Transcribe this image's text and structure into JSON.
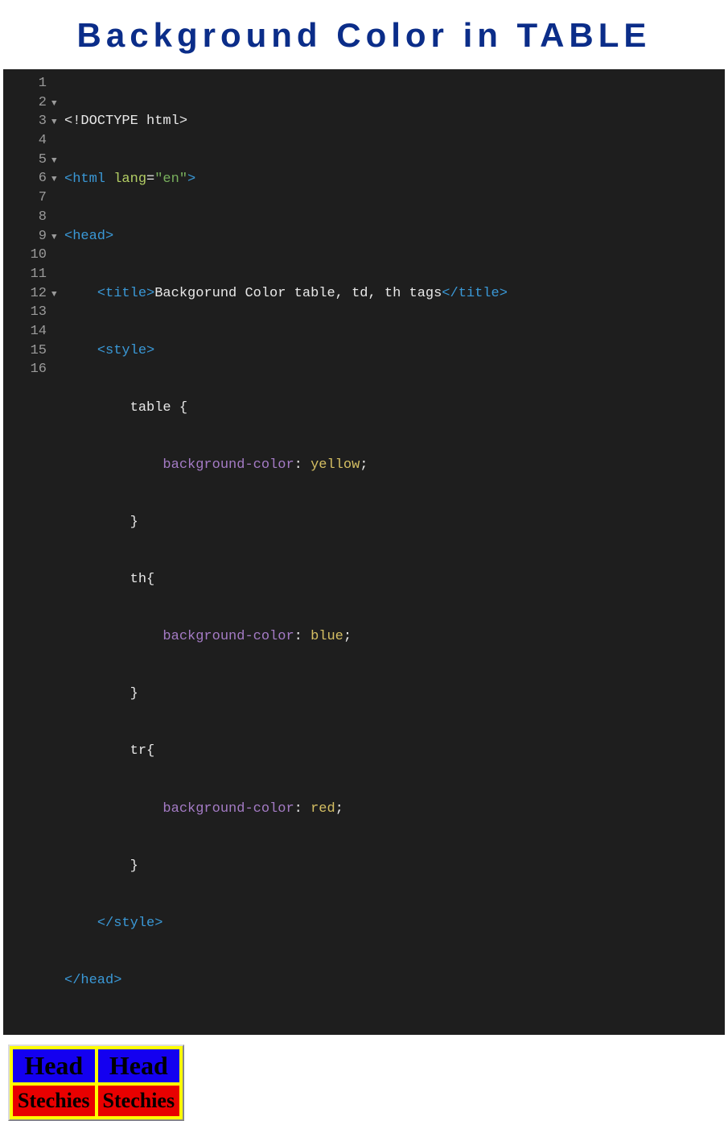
{
  "title": "Background Color in TABLE",
  "code": {
    "line1": {
      "text": "<!DOCTYPE html>"
    },
    "line2": {
      "open": "<",
      "tag": "html",
      "attr": "lang",
      "eq": "=",
      "val": "\"en\"",
      "close": ">"
    },
    "line3": {
      "open": "<",
      "tag": "head",
      "close": ">"
    },
    "line4": {
      "indent": "    ",
      "open": "<",
      "tag": "title",
      "close1": ">",
      "text": "Backgorund Color table, td, th tags",
      "open2": "</",
      "tag2": "title",
      "close2": ">"
    },
    "line5": {
      "indent": "    ",
      "open": "<",
      "tag": "style",
      "close": ">"
    },
    "line6": {
      "indent": "        ",
      "sel": "table {"
    },
    "line7": {
      "indent": "            ",
      "prop": "background-color",
      "colon": ": ",
      "val": "yellow",
      "semi": ";"
    },
    "line8": {
      "indent": "        ",
      "brace": "}"
    },
    "line9": {
      "indent": "        ",
      "sel": "th{"
    },
    "line10": {
      "indent": "            ",
      "prop": "background-color",
      "colon": ": ",
      "val": "blue",
      "semi": ";"
    },
    "line11": {
      "indent": "        ",
      "brace": "}"
    },
    "line12": {
      "indent": "        ",
      "sel": "tr{"
    },
    "line13": {
      "indent": "            ",
      "prop": "background-color",
      "colon": ": ",
      "val": "red",
      "semi": ";"
    },
    "line14": {
      "indent": "        ",
      "brace": "}"
    },
    "line15": {
      "indent": "    ",
      "open": "</",
      "tag": "style",
      "close": ">"
    },
    "line16": {
      "open": "</",
      "tag": "head",
      "close": ">"
    }
  },
  "gutter": [
    "1",
    "2",
    "3",
    "4",
    "5",
    "6",
    "7",
    "8",
    "9",
    "10",
    "11",
    "12",
    "13",
    "14",
    "15",
    "16"
  ],
  "folds": [
    "",
    "▼",
    "▼",
    "",
    "▼",
    "▼",
    "",
    "",
    "▼",
    "",
    "",
    "▼",
    "",
    "",
    "",
    ""
  ],
  "preview": {
    "head1": "Head",
    "head2": "Head",
    "cell1": "Stechies",
    "cell2": "Stechies"
  }
}
